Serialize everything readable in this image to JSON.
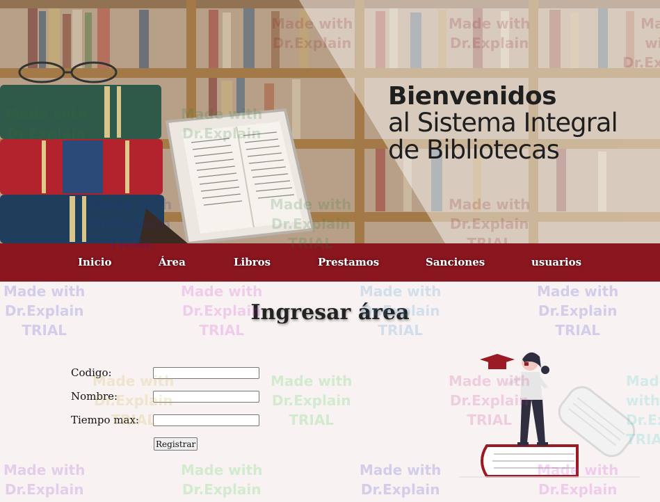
{
  "banner": {
    "line1": "Bienvenidos",
    "line2": "al Sistema Integral",
    "line3": "de Bibliotecas"
  },
  "nav": {
    "items": [
      {
        "label": "Inicio"
      },
      {
        "label": "Área"
      },
      {
        "label": "Libros"
      },
      {
        "label": "Prestamos"
      },
      {
        "label": "Sanciones"
      },
      {
        "label": "usuarios"
      }
    ]
  },
  "page": {
    "title": "Ingresar área"
  },
  "form": {
    "codigo_label": "Codigo:",
    "codigo_value": "",
    "nombre_label": "Nombre:",
    "nombre_value": "",
    "tiempo_label": "Tiempo max:",
    "tiempo_value": "",
    "submit_label": "Registrar"
  },
  "watermark": {
    "line1": "Made with",
    "line2": "Dr.Explain",
    "line3": "TRIAL"
  },
  "colors": {
    "nav_bg": "#8a1620",
    "page_bg": "#f8f2f2",
    "accent_red": "#9b1b24"
  },
  "icons": [
    "graduation-cap-icon"
  ]
}
